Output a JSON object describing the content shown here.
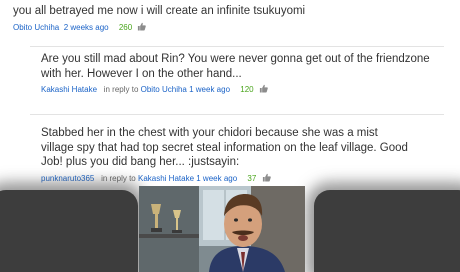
{
  "comments": [
    {
      "text": "you all betrayed me now i will create an infinite tsukuyomi",
      "user": "Obito Uchiha",
      "time": "2 weeks ago",
      "votes": "260"
    },
    {
      "text": "Are you still mad about Rin? You were never gonna get out of the friendzone with her. However I on the other hand...",
      "user": "Kakashi Hatake",
      "reply_prefix": "in reply to",
      "reply_to": "Obito Uchiha",
      "time": "1 week ago",
      "votes": "120"
    },
    {
      "text": "Stabbed her in the chest with your chidori because she was a mist village spy that had top secret steal information on the leaf village. Good Job! plus you did bang her... :justsayin:",
      "user": "punknaruto365",
      "reply_prefix": "in reply to",
      "reply_to": "Kakashi Hatake",
      "time": "1 week ago",
      "votes": "37"
    }
  ],
  "icons": {
    "vote": "thumbs-up-icon"
  },
  "colors": {
    "username": "#1b63c7",
    "votes": "#4aa51c",
    "text": "#333333"
  },
  "reaction_image": {
    "subject": "surprised man in office with trophies"
  }
}
